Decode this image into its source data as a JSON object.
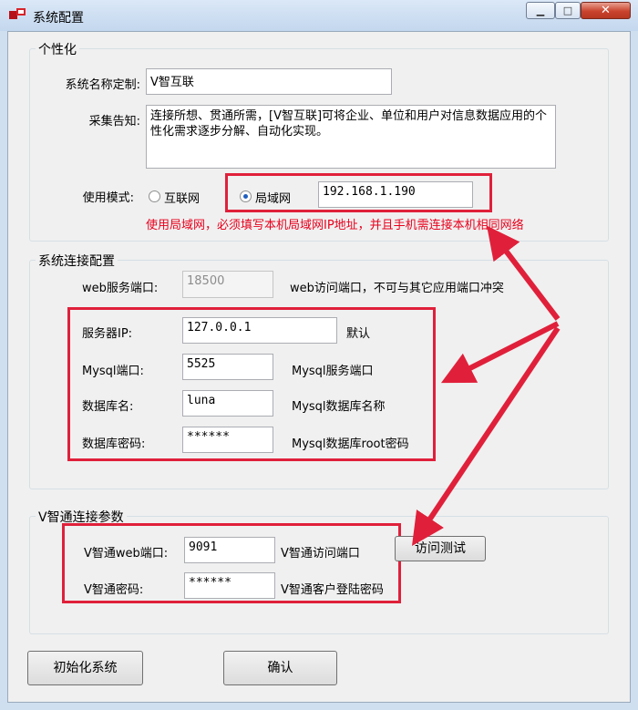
{
  "window": {
    "title": "系统配置",
    "min_glyph": "▁",
    "max_glyph": "□",
    "close_glyph": "✕"
  },
  "personalization": {
    "legend": "个性化",
    "name_label": "系统名称定制:",
    "name_value": "V智互联",
    "notice_label": "采集告知:",
    "notice_value": "连接所想、贯通所需，[V智互联]可将企业、单位和用户对信息数据应用的个性化需求逐步分解、自动化实现。",
    "mode_label": "使用模式:",
    "mode_internet": "互联网",
    "mode_lan": "局域网",
    "mode_selected": "局域网",
    "lan_ip": "192.168.1.190",
    "lan_note": "使用局域网，必须填写本机局域网IP地址，并且手机需连接本机相同网络"
  },
  "connection": {
    "legend": "系统连接配置",
    "web_port_label": "web服务端口:",
    "web_port_value": "18500",
    "web_port_note": "web访问端口，不可与其它应用端口冲突",
    "server_ip_label": "服务器IP:",
    "server_ip_value": "127.0.0.1",
    "server_ip_note": "默认",
    "mysql_port_label": "Mysql端口:",
    "mysql_port_value": "5525",
    "mysql_port_note": "Mysql服务端口",
    "db_name_label": "数据库名:",
    "db_name_value": "luna",
    "db_name_note": "Mysql数据库名称",
    "db_pwd_label": "数据库密码:",
    "db_pwd_value": "******",
    "db_pwd_note": "Mysql数据库root密码"
  },
  "vzhitong": {
    "legend": "V智通连接参数",
    "web_port_label": "V智通web端口:",
    "web_port_value": "9091",
    "web_port_note": "V智通访问端口",
    "test_button": "访问测试",
    "pwd_label": "V智通密码:",
    "pwd_value": "******",
    "pwd_note": "V智通客户登陆密码"
  },
  "footer": {
    "init_button": "初始化系统",
    "confirm_button": "确认"
  },
  "colors": {
    "annotation_red": "#e0203a",
    "window_frame": "#cfdff0"
  }
}
